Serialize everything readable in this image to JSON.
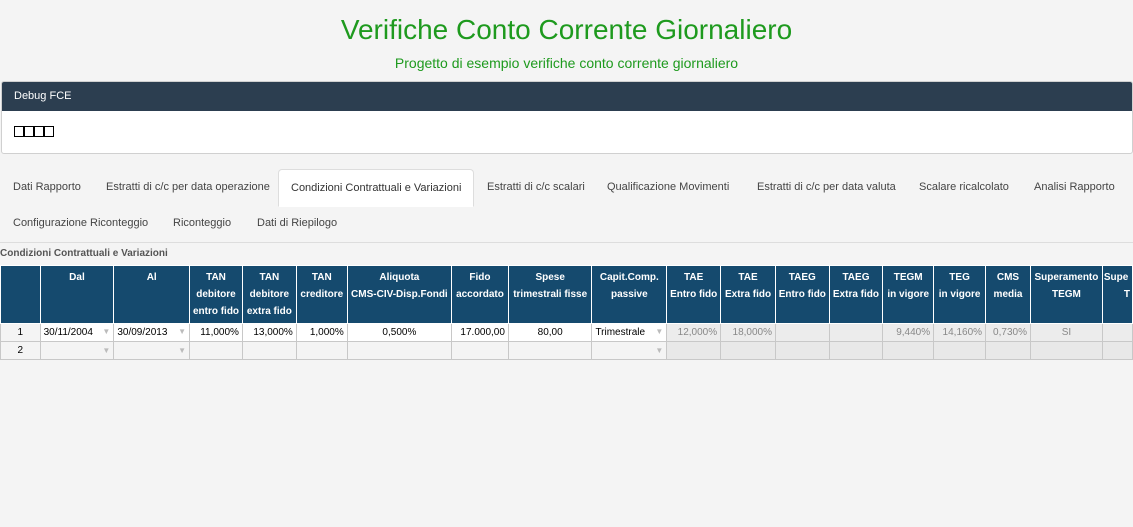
{
  "header": {
    "title": "Verifiche Conto Corrente Giornaliero",
    "subtitle": "Progetto di esempio verifiche conto corrente giornaliero"
  },
  "debug": {
    "title": "Debug FCE"
  },
  "tabs": [
    {
      "label": "Dati Rapporto"
    },
    {
      "label": "Estratti di c/c per data operazione"
    },
    {
      "label": "Condizioni Contrattuali e Variazioni"
    },
    {
      "label": "Estratti di c/c scalari"
    },
    {
      "label": "Qualificazione Movimenti"
    },
    {
      "label": "Estratti di c/c per data valuta"
    },
    {
      "label": "Scalare ricalcolato"
    },
    {
      "label": "Analisi Rapporto"
    },
    {
      "label": "Configurazione Riconteggio"
    },
    {
      "label": "Riconteggio"
    },
    {
      "label": "Dati di Riepilogo"
    }
  ],
  "section": {
    "label": "Condizioni Contrattuali e Variazioni"
  },
  "table": {
    "columns": [
      {
        "l1": "",
        "l2": "",
        "l3": ""
      },
      {
        "l1": "Dal",
        "l2": "",
        "l3": ""
      },
      {
        "l1": "Al",
        "l2": "",
        "l3": ""
      },
      {
        "l1": "TAN",
        "l2": "debitore",
        "l3": "entro fido"
      },
      {
        "l1": "TAN",
        "l2": "debitore",
        "l3": "extra fido"
      },
      {
        "l1": "TAN",
        "l2": "creditore",
        "l3": ""
      },
      {
        "l1": "Aliquota",
        "l2": "CMS-CIV-Disp.Fondi",
        "l3": ""
      },
      {
        "l1": "Fido",
        "l2": "accordato",
        "l3": ""
      },
      {
        "l1": "Spese",
        "l2": "trimestrali fisse",
        "l3": ""
      },
      {
        "l1": "Capit.Comp.",
        "l2": "passive",
        "l3": ""
      },
      {
        "l1": "TAE",
        "l2": "Entro fido",
        "l3": ""
      },
      {
        "l1": "TAE",
        "l2": "Extra fido",
        "l3": ""
      },
      {
        "l1": "TAEG",
        "l2": "Entro fido",
        "l3": ""
      },
      {
        "l1": "TAEG",
        "l2": "Extra fido",
        "l3": ""
      },
      {
        "l1": "TEGM",
        "l2": "in vigore",
        "l3": ""
      },
      {
        "l1": "TEG",
        "l2": "in vigore",
        "l3": ""
      },
      {
        "l1": "CMS",
        "l2": "media",
        "l3": ""
      },
      {
        "l1": "Superamento",
        "l2": "TEGM",
        "l3": ""
      },
      {
        "l1": "Supe",
        "l2": "T",
        "l3": ""
      }
    ],
    "rows": [
      {
        "num": "1",
        "dal": "30/11/2004",
        "al": "30/09/2013",
        "tan_entro": "11,000%",
        "tan_extra": "13,000%",
        "tan_cred": "1,000%",
        "aliquota": "0,500%",
        "fido": "17.000,00",
        "spese": "80,00",
        "capit": "Trimestrale",
        "tae_entro": "12,000%",
        "tae_extra": "18,000%",
        "taeg_entro": "",
        "taeg_extra": "",
        "tegm": "9,440%",
        "teg": "14,160%",
        "cms": "0,730%",
        "superamento": "SI"
      },
      {
        "num": "2"
      }
    ]
  }
}
